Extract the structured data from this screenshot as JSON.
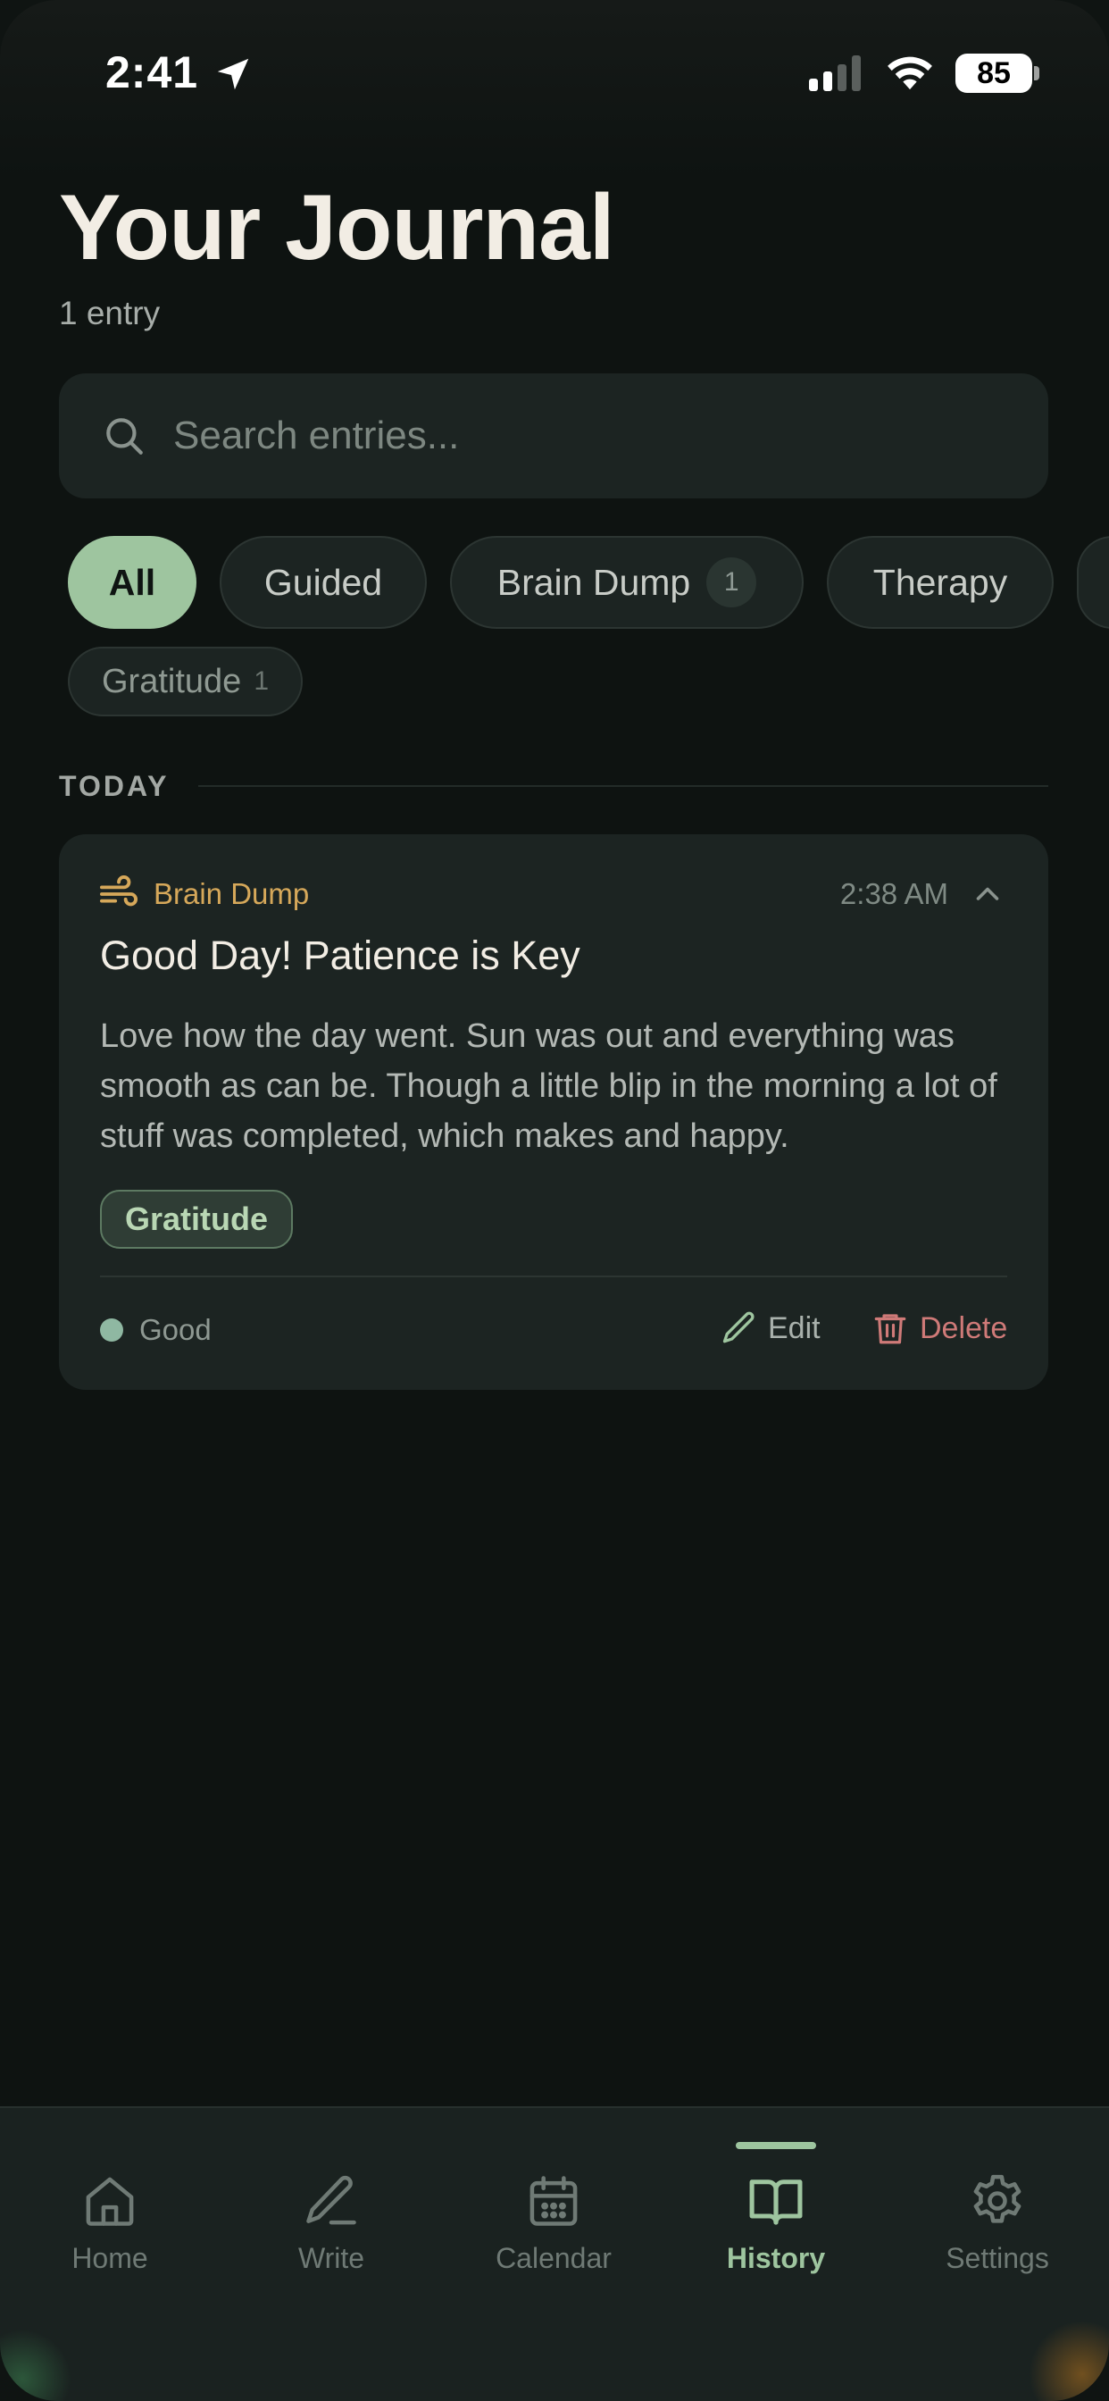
{
  "status_bar": {
    "time": "2:41",
    "battery": "85"
  },
  "header": {
    "title": "Your Journal",
    "subtitle": "1 entry"
  },
  "search": {
    "placeholder": "Search entries..."
  },
  "filters": [
    {
      "label": "All",
      "active": true
    },
    {
      "label": "Guided"
    },
    {
      "label": "Brain Dump",
      "count": "1"
    },
    {
      "label": "Therapy"
    },
    {
      "label": "Gratitude",
      "count": "1"
    }
  ],
  "section": {
    "label": "TODAY"
  },
  "entry": {
    "category": "Brain Dump",
    "category_icon": "wind-icon",
    "time": "2:38 AM",
    "title": "Good Day! Patience is Key",
    "body": "Love how the day went. Sun was out and everything was smooth as can be. Though a little blip in the morning a lot of stuff was completed, which makes and happy.",
    "tag": "Gratitude",
    "mood": "Good",
    "edit_label": "Edit",
    "delete_label": "Delete"
  },
  "tabbar": {
    "items": [
      {
        "label": "Home",
        "icon": "home-icon"
      },
      {
        "label": "Write",
        "icon": "pencil-icon"
      },
      {
        "label": "Calendar",
        "icon": "calendar-icon"
      },
      {
        "label": "History",
        "icon": "book-icon",
        "active": true
      },
      {
        "label": "Settings",
        "icon": "gear-icon"
      }
    ]
  },
  "colors": {
    "background": "#0e1311",
    "card": "#1c2422",
    "accent": "#9ec59f",
    "category": "#d6a85a",
    "delete": "#cf7a78"
  }
}
